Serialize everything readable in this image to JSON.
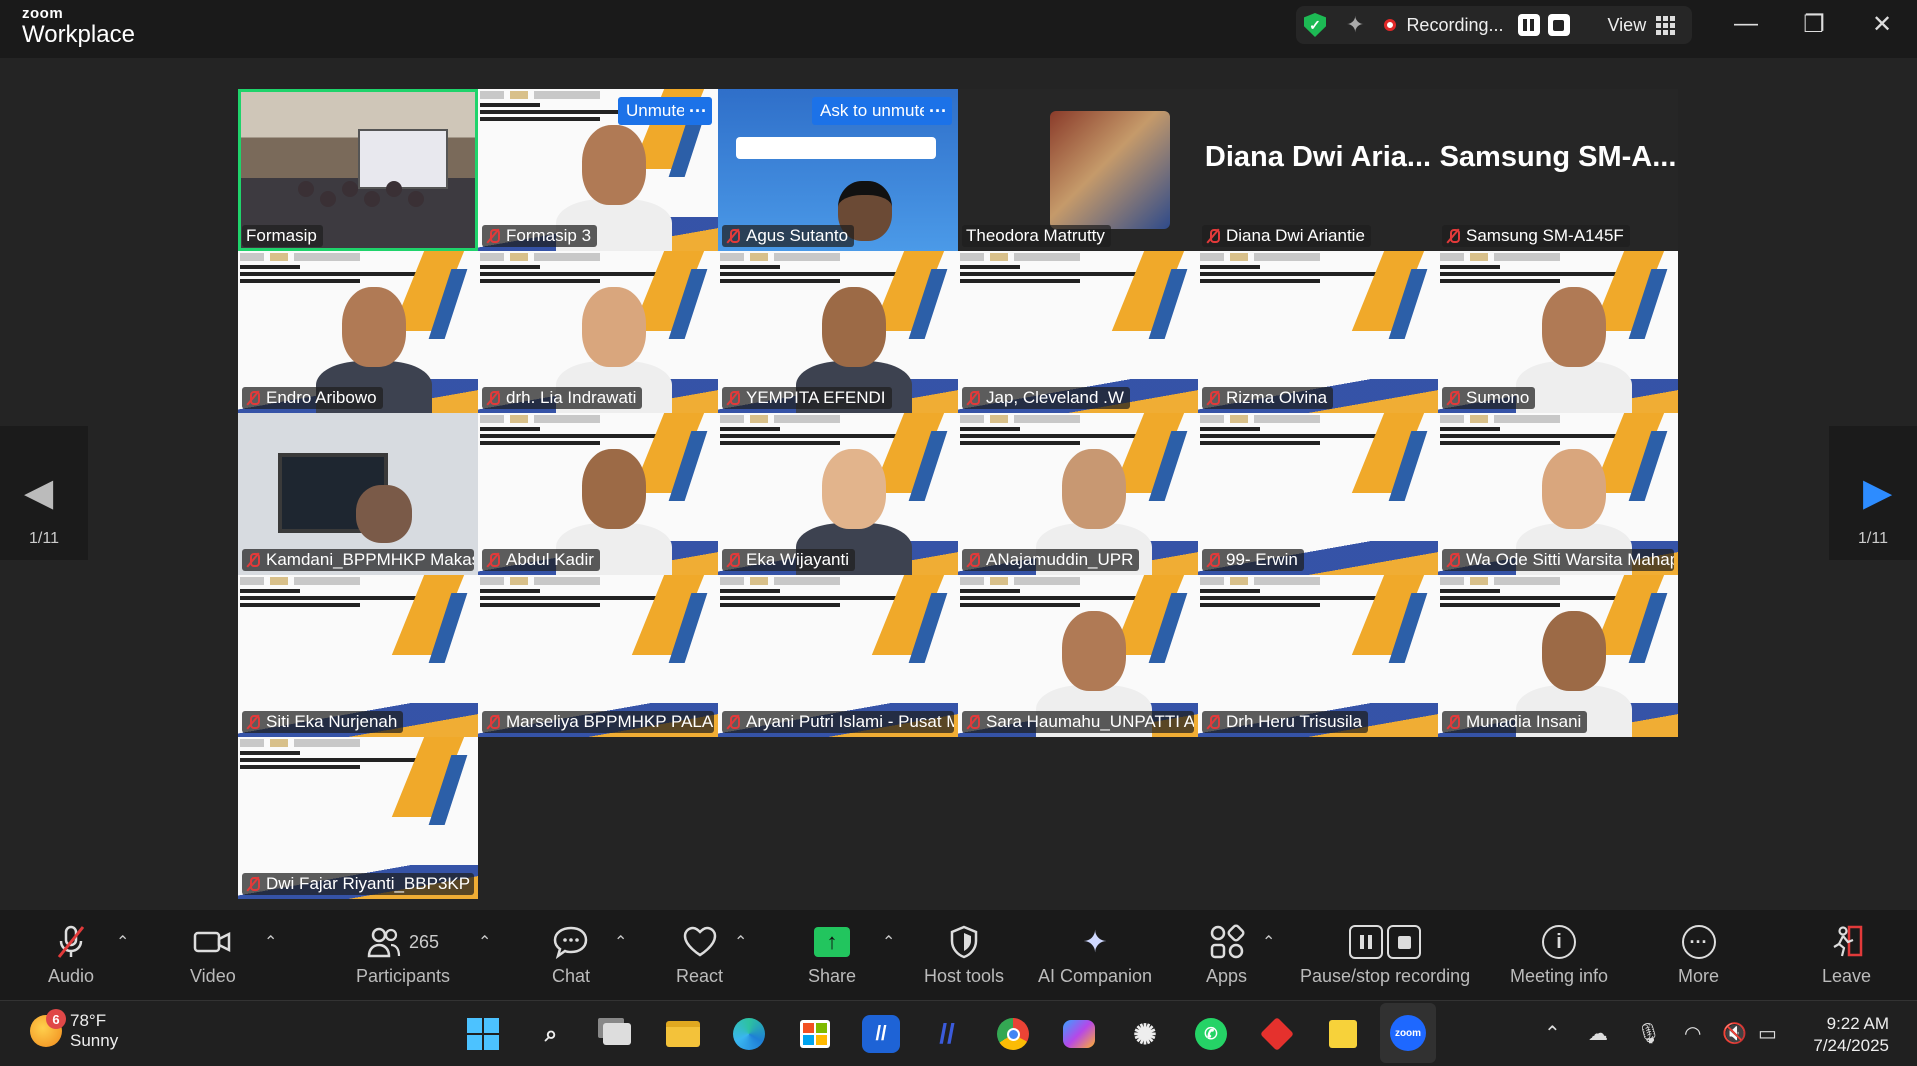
{
  "app": {
    "brand_top": "zoom",
    "brand_bottom": "Workplace"
  },
  "status_bar": {
    "recording_label": "Recording...",
    "view_label": "View"
  },
  "window_controls": {
    "minimize": "—",
    "maximize": "❐",
    "close": "✕"
  },
  "pager": {
    "left_count": "1/11",
    "right_count": "1/11"
  },
  "tile_controls": {
    "unmute": "Unmute",
    "ask_to_unmute": "Ask to unmute",
    "more": "···"
  },
  "participants": [
    {
      "name": "Formasip",
      "muted": false,
      "active": true,
      "type": "room"
    },
    {
      "name": "Formasip 3",
      "muted": true,
      "type": "slide-person"
    },
    {
      "name": "Agus Sutanto",
      "muted": true,
      "type": "poster"
    },
    {
      "name": "Theodora Matrutty",
      "muted": false,
      "type": "avatar"
    },
    {
      "name": "Diana Dwi Ariantie",
      "muted": true,
      "type": "name-only",
      "big_name": "Diana Dwi Aria..."
    },
    {
      "name": "Samsung SM-A145F",
      "muted": true,
      "type": "name-only",
      "big_name": "Samsung SM-A..."
    },
    {
      "name": "Endro Aribowo",
      "muted": true,
      "type": "slide-person"
    },
    {
      "name": "drh. Lia Indrawati",
      "muted": true,
      "type": "slide-person"
    },
    {
      "name": "YEMPITA EFENDI",
      "muted": true,
      "type": "slide-person"
    },
    {
      "name": "Jap, Cleveland .W",
      "muted": true,
      "type": "slide"
    },
    {
      "name": "Rizma Olvina",
      "muted": true,
      "type": "slide"
    },
    {
      "name": "Sumono",
      "muted": true,
      "type": "slide-person"
    },
    {
      "name": "Kamdani_BPPMHKP Makassar",
      "muted": true,
      "type": "office"
    },
    {
      "name": "Abdul Kadir",
      "muted": true,
      "type": "slide-person"
    },
    {
      "name": "Eka Wijayanti",
      "muted": true,
      "type": "slide-person"
    },
    {
      "name": "ANajamuddin_UPR",
      "muted": true,
      "type": "slide-person"
    },
    {
      "name": "99- Erwin",
      "muted": true,
      "type": "slide"
    },
    {
      "name": "Wa Ode Sitti Warsita Mahap...",
      "muted": true,
      "type": "slide-person"
    },
    {
      "name": "Siti Eka Nurjenah",
      "muted": true,
      "type": "slide"
    },
    {
      "name": "Marseliya BPPMHKP PALAN...",
      "muted": true,
      "type": "slide"
    },
    {
      "name": "Aryani Putri Islami - Pusat M...",
      "muted": true,
      "type": "slide"
    },
    {
      "name": "Sara Haumahu_UNPATTI Am...",
      "muted": true,
      "type": "slide-person"
    },
    {
      "name": "Drh Heru Trisusila",
      "muted": true,
      "type": "slide"
    },
    {
      "name": "Munadia Insani",
      "muted": true,
      "type": "slide-person"
    },
    {
      "name": "Dwi Fajar Riyanti_BBP3KP",
      "muted": true,
      "type": "slide"
    }
  ],
  "toolbar": {
    "audio": "Audio",
    "video": "Video",
    "participants": "Participants",
    "participants_count": "265",
    "chat": "Chat",
    "react": "React",
    "share": "Share",
    "host_tools": "Host tools",
    "ai_companion": "AI Companion",
    "apps": "Apps",
    "pause_stop_recording": "Pause/stop recording",
    "meeting_info": "Meeting info",
    "more": "More",
    "leave": "Leave"
  },
  "taskbar": {
    "temperature": "78°F",
    "condition": "Sunny",
    "weather_badge": "6",
    "time": "9:22 AM",
    "date": "7/24/2025"
  },
  "colors": {
    "accent_blue": "#1c72e8",
    "active_speaker": "#1fd36b",
    "muted_red": "#e23a3a",
    "share_green": "#22c55e"
  }
}
